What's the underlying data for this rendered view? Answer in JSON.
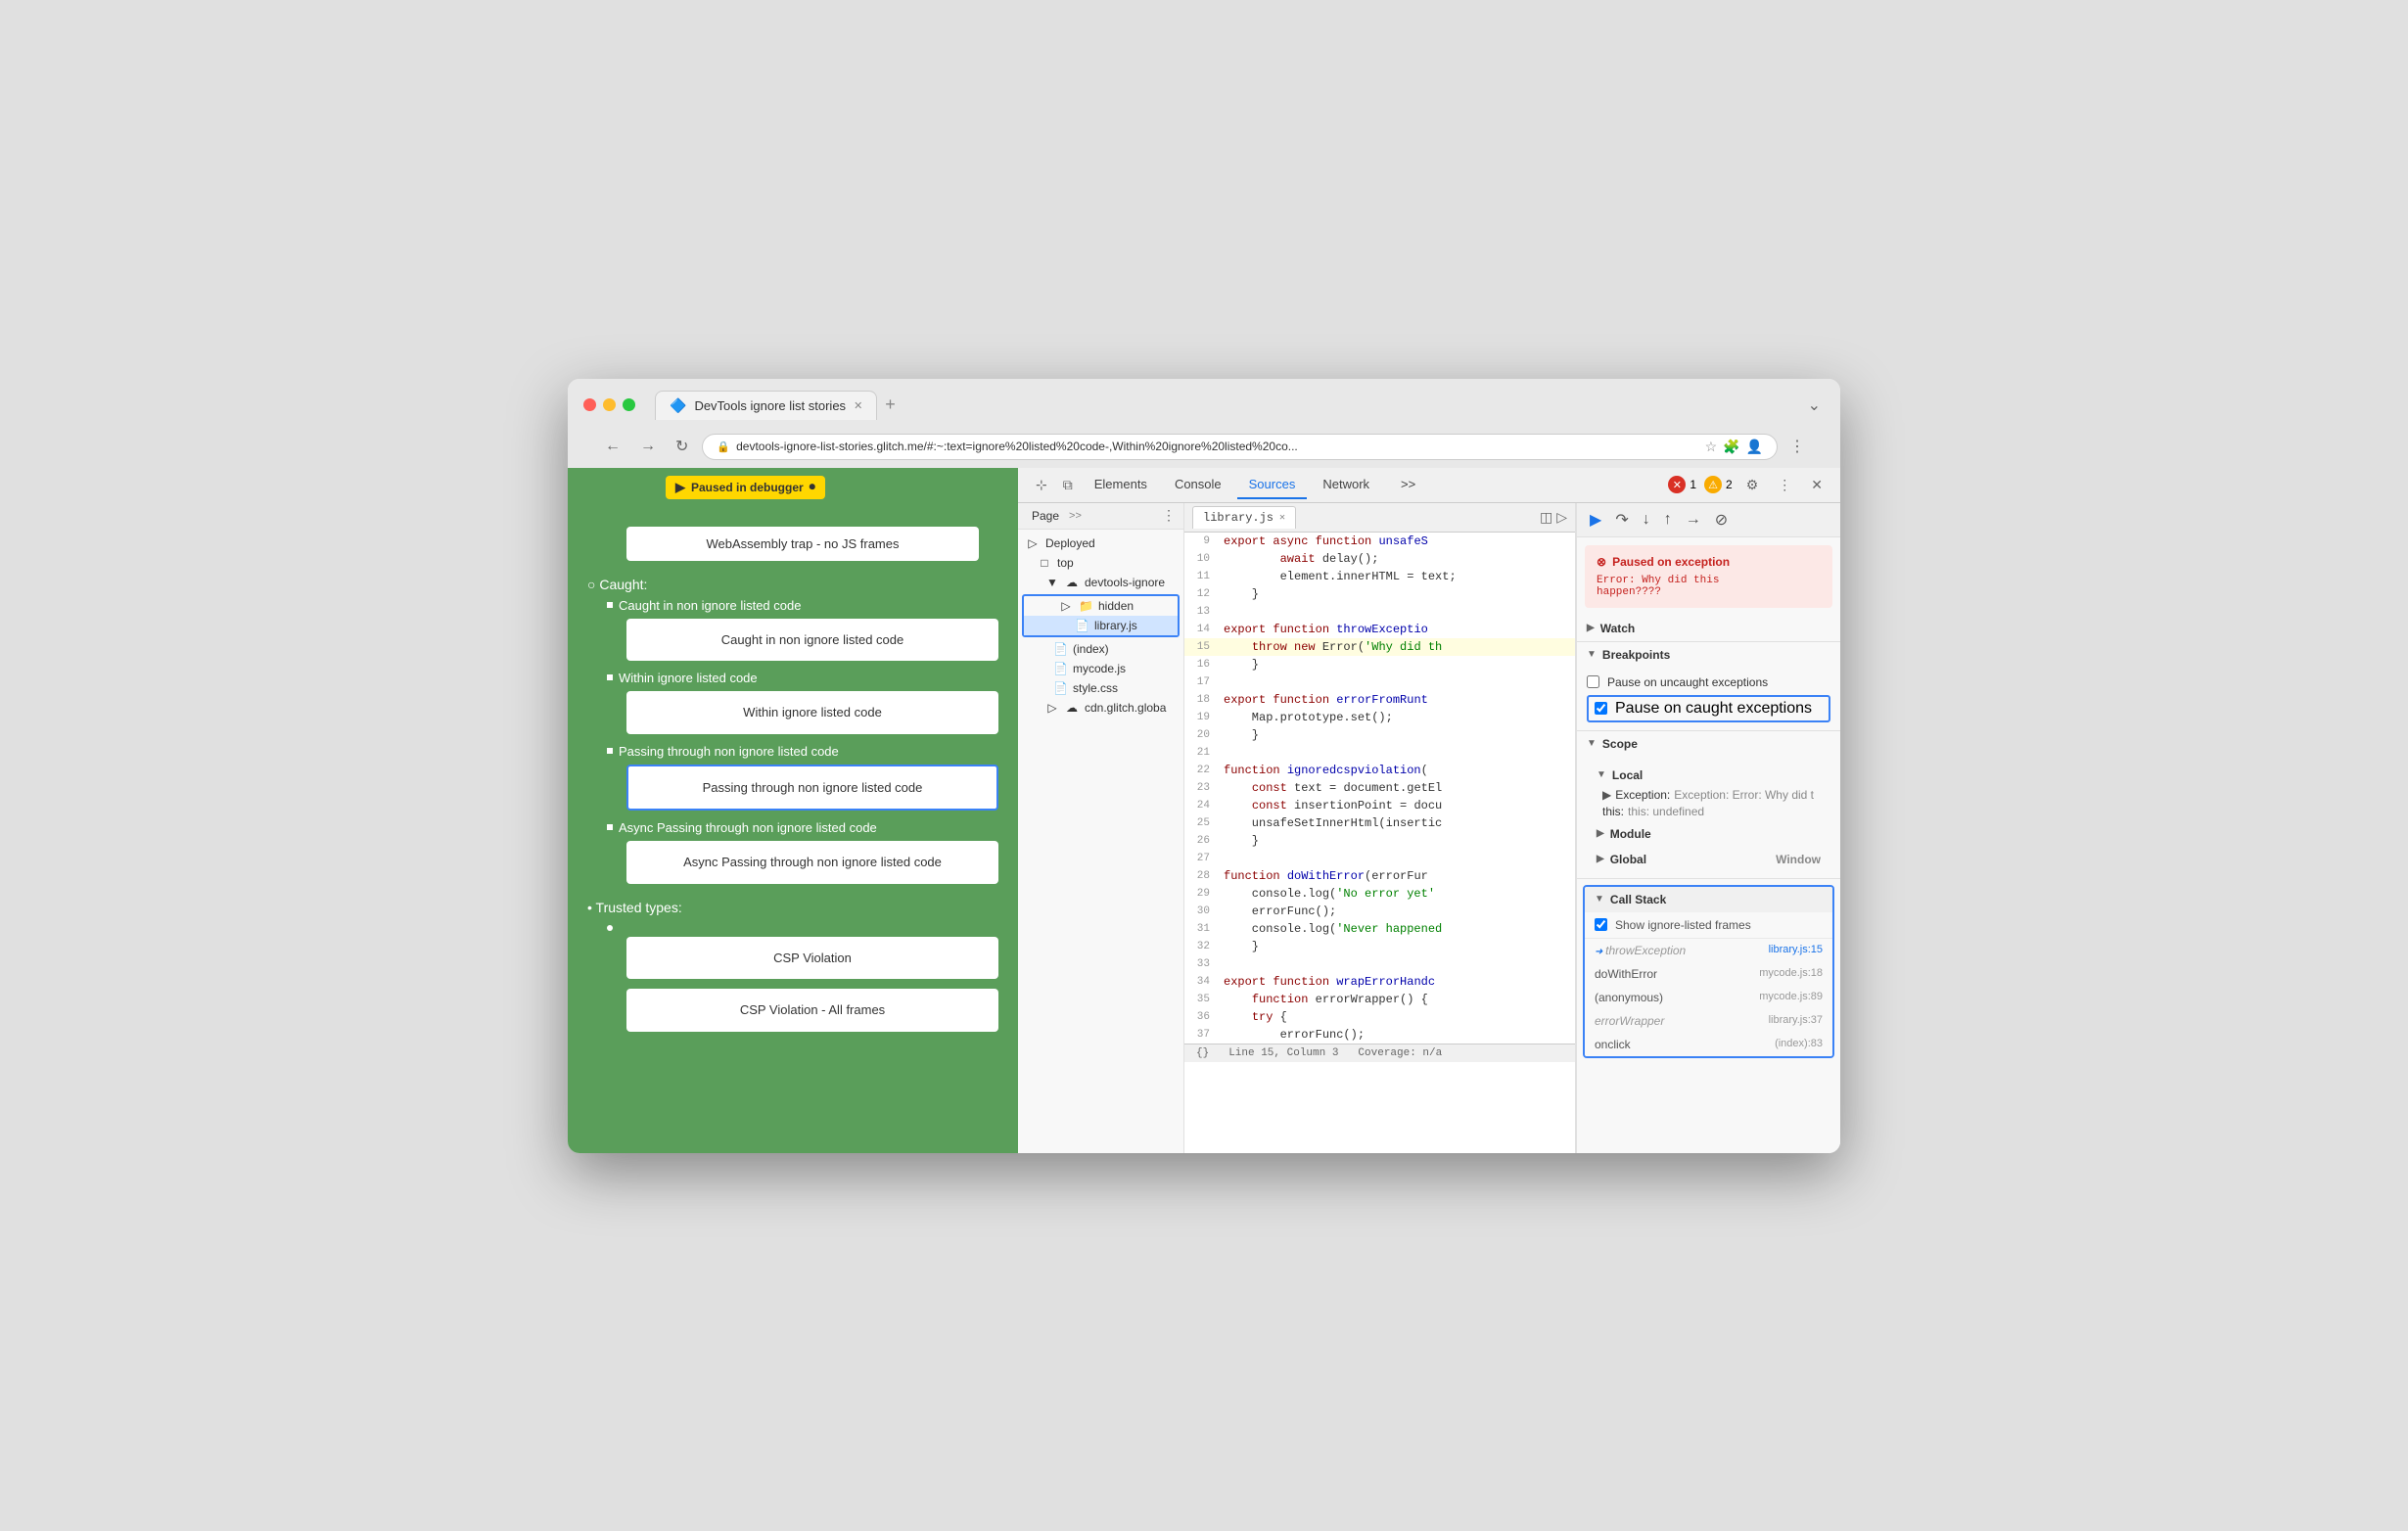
{
  "browser": {
    "tab_title": "DevTools ignore list stories",
    "tab_icon": "🔷",
    "url": "devtools-ignore-list-stories.glitch.me/#:~:text=ignore%20listed%20code-,Within%20ignore%20listed%20co...",
    "paused_badge": "Paused in debugger",
    "paused_icon": "▶"
  },
  "left_panel": {
    "webassembly_label": "WebAssembly trap -\nno JS frames",
    "caught_label": "Caught:",
    "items": [
      {
        "label": "Caught in non ignore listed code",
        "box_label": "Caught in non ignore\nlisted code",
        "highlighted": false
      },
      {
        "label": "Within ignore listed code",
        "box_label": "Within ignore listed\ncode",
        "highlighted": false
      },
      {
        "label": "Passing through non ignore listed code",
        "box_label": "Passing through non\nignore listed code",
        "highlighted": true
      },
      {
        "label": "Async Passing through non ignore listed code",
        "box_label": "Async Passing\nthrough non ignore\nlisted code",
        "highlighted": false
      }
    ],
    "trusted_label": "Trusted types:",
    "trusted_items": [
      "CSP Violation",
      "CSP Violation - All frames"
    ]
  },
  "devtools": {
    "tabs": [
      "Elements",
      "Console",
      "Sources",
      "Network",
      ">>"
    ],
    "active_tab": "Sources",
    "error_count": "1",
    "warning_count": "2"
  },
  "sources": {
    "active_tab": "Page",
    "more_label": ">>",
    "file_tree": {
      "deployed_label": "Deployed",
      "top_label": "top",
      "devtools_folder": "devtools-ignore",
      "hidden_folder": "hidden",
      "library_file": "library.js",
      "index_file": "(index)",
      "mycode_file": "mycode.js",
      "style_file": "style.css",
      "cdn_folder": "cdn.glitch.globa"
    }
  },
  "editor": {
    "file_name": "library.js",
    "lines": [
      {
        "num": "9",
        "content": "    export async function unsafeS"
      },
      {
        "num": "10",
        "content": "        await delay();"
      },
      {
        "num": "11",
        "content": "        element.innerHTML = text;"
      },
      {
        "num": "12",
        "content": "    }"
      },
      {
        "num": "13",
        "content": ""
      },
      {
        "num": "14",
        "content": "    export function throwExceptio"
      },
      {
        "num": "15",
        "content": "        throw new Error('Why did th",
        "highlight": true
      },
      {
        "num": "16",
        "content": "    }"
      },
      {
        "num": "17",
        "content": ""
      },
      {
        "num": "18",
        "content": "    export function errorFromRunt"
      },
      {
        "num": "19",
        "content": "        Map.prototype.set();"
      },
      {
        "num": "20",
        "content": "    }"
      },
      {
        "num": "21",
        "content": ""
      },
      {
        "num": "22",
        "content": "    function ignoredcspviolation("
      },
      {
        "num": "23",
        "content": "        const text = document.getEl"
      },
      {
        "num": "24",
        "content": "        const insertionPoint = docu"
      },
      {
        "num": "25",
        "content": "        unsafeSetInnerHtml(insertic"
      },
      {
        "num": "26",
        "content": "    }"
      },
      {
        "num": "27",
        "content": ""
      },
      {
        "num": "28",
        "content": "    function doWithError(errorFur"
      },
      {
        "num": "29",
        "content": "        console.log('No error yet'"
      },
      {
        "num": "30",
        "content": "        errorFunc();"
      },
      {
        "num": "31",
        "content": "        console.log('Never happened"
      },
      {
        "num": "32",
        "content": "    }"
      },
      {
        "num": "33",
        "content": ""
      },
      {
        "num": "34",
        "content": "    export function wrapErrorHandc"
      },
      {
        "num": "35",
        "content": "        function errorWrapper() {"
      },
      {
        "num": "36",
        "content": "        try {"
      },
      {
        "num": "37",
        "content": "            errorFunc();"
      }
    ],
    "status_bar": {
      "position": "Line 15, Column 3",
      "coverage": "Coverage: n/a"
    }
  },
  "right_panel": {
    "exception_title": "Paused on exception",
    "exception_msg": "Error: Why did this\nhappen????",
    "sections": {
      "watch": "Watch",
      "breakpoints": "Breakpoints",
      "pause_uncaught": "Pause on uncaught exceptions",
      "pause_caught": "Pause on caught exceptions",
      "pause_caught_checked": true,
      "scope": "Scope",
      "local": "Local",
      "local_exception": "Exception: Error: Why did t",
      "local_this": "this: undefined",
      "module": "Module",
      "global": "Global",
      "global_val": "Window"
    },
    "callstack": {
      "title": "Call Stack",
      "show_ignore": "Show ignore-listed frames",
      "show_ignore_checked": true,
      "frames": [
        {
          "fn": "throwException",
          "file": "library.js:15",
          "active": true,
          "muted": true
        },
        {
          "fn": "doWithError",
          "file": "mycode.js:18",
          "active": false,
          "muted": false
        },
        {
          "fn": "(anonymous)",
          "file": "mycode.js:89",
          "active": false,
          "muted": false
        },
        {
          "fn": "errorWrapper",
          "file": "library.js:37",
          "active": false,
          "muted": true
        },
        {
          "fn": "onclick",
          "file": "(index):83",
          "active": false,
          "muted": false
        }
      ]
    }
  }
}
